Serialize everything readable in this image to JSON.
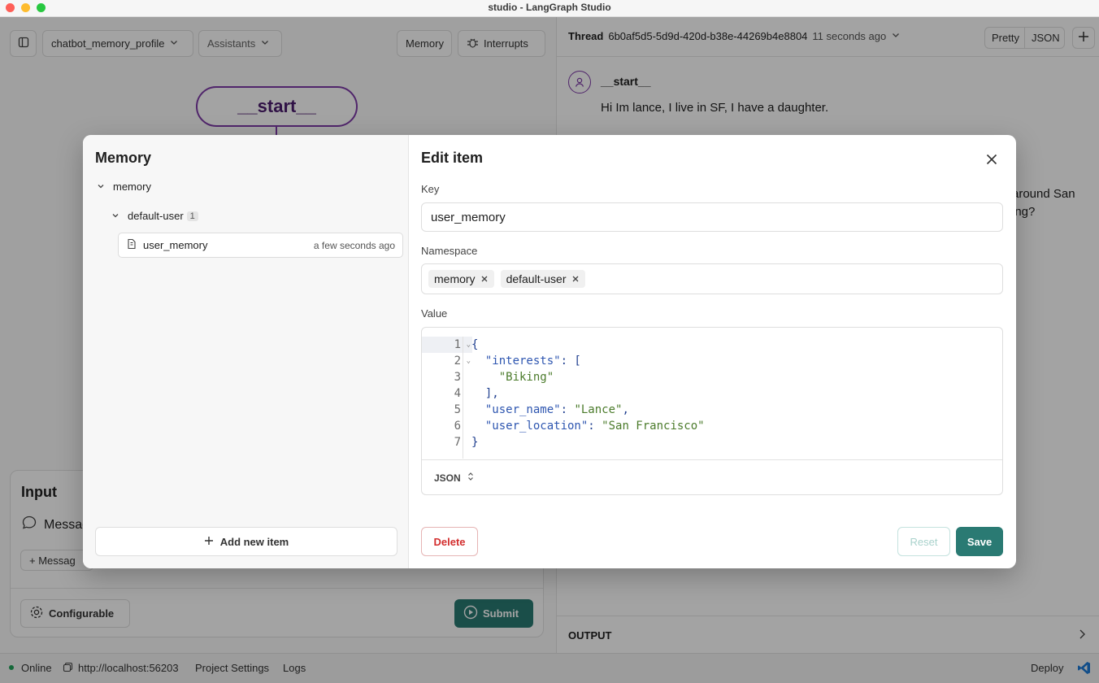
{
  "window_title": "studio - LangGraph Studio",
  "toolbar": {
    "graph_select": "chatbot_memory_profile",
    "assistants_label": "Assistants",
    "memory_label": "Memory",
    "interrupts_label": "Interrupts"
  },
  "graph": {
    "start_node": "__start__"
  },
  "input_panel": {
    "title": "Input",
    "messages_label": "Messag",
    "add_message_label": "+ Messag",
    "configurable_label": "Configurable",
    "submit_label": "Submit"
  },
  "thread": {
    "label": "Thread",
    "id": "6b0af5d5-5d9d-420d-b38e-44269b4e8804",
    "time": "11 seconds ago",
    "pretty_label": "Pretty",
    "json_label": "JSON",
    "node_name": "__start__",
    "message": "Hi Im lance, I live in SF, I have a daughter.",
    "partial_line_1": "around San",
    "partial_line_2": "ing?",
    "output_label": "OUTPUT"
  },
  "status_bar": {
    "online": "Online",
    "url": "http://localhost:56203",
    "project_settings": "Project Settings",
    "logs": "Logs",
    "deploy": "Deploy"
  },
  "memory_modal": {
    "title": "Memory",
    "tree": {
      "root": "memory",
      "user": "default-user",
      "user_count": "1",
      "item_name": "user_memory",
      "item_time": "a few seconds ago"
    },
    "add_new_item": "Add new item",
    "edit_title": "Edit item",
    "key_label": "Key",
    "key_value": "user_memory",
    "namespace_label": "Namespace",
    "namespace_chips": [
      "memory",
      "default-user"
    ],
    "value_label": "Value",
    "value_code": {
      "line_numbers": [
        "1",
        "2",
        "3",
        "4",
        "5",
        "6",
        "7"
      ],
      "lines": {
        "l1": "{",
        "l2_key": "  \"interests\"",
        "l2_rest": ": [",
        "l3": "    \"Biking\"",
        "l4": "  ],",
        "l5_key": "  \"user_name\"",
        "l5_sep": ": ",
        "l5_val": "\"Lance\"",
        "l5_end": ",",
        "l6_key": "  \"user_location\"",
        "l6_sep": ": ",
        "l6_val": "\"San Francisco\"",
        "l7": "}"
      }
    },
    "format_label": "JSON",
    "delete_label": "Delete",
    "reset_label": "Reset",
    "save_label": "Save"
  },
  "colors": {
    "accent": "#2a7a73",
    "graph_node": "#7e3aa8",
    "danger": "#d32f2f"
  },
  "icons": [
    "sidebar-toggle-icon",
    "chevron-down-icon",
    "bug-icon",
    "user-icon",
    "plus-icon",
    "chat-bubble-icon",
    "gear-icon",
    "play-icon",
    "close-icon",
    "document-icon",
    "copy-icon",
    "vscode-icon"
  ]
}
